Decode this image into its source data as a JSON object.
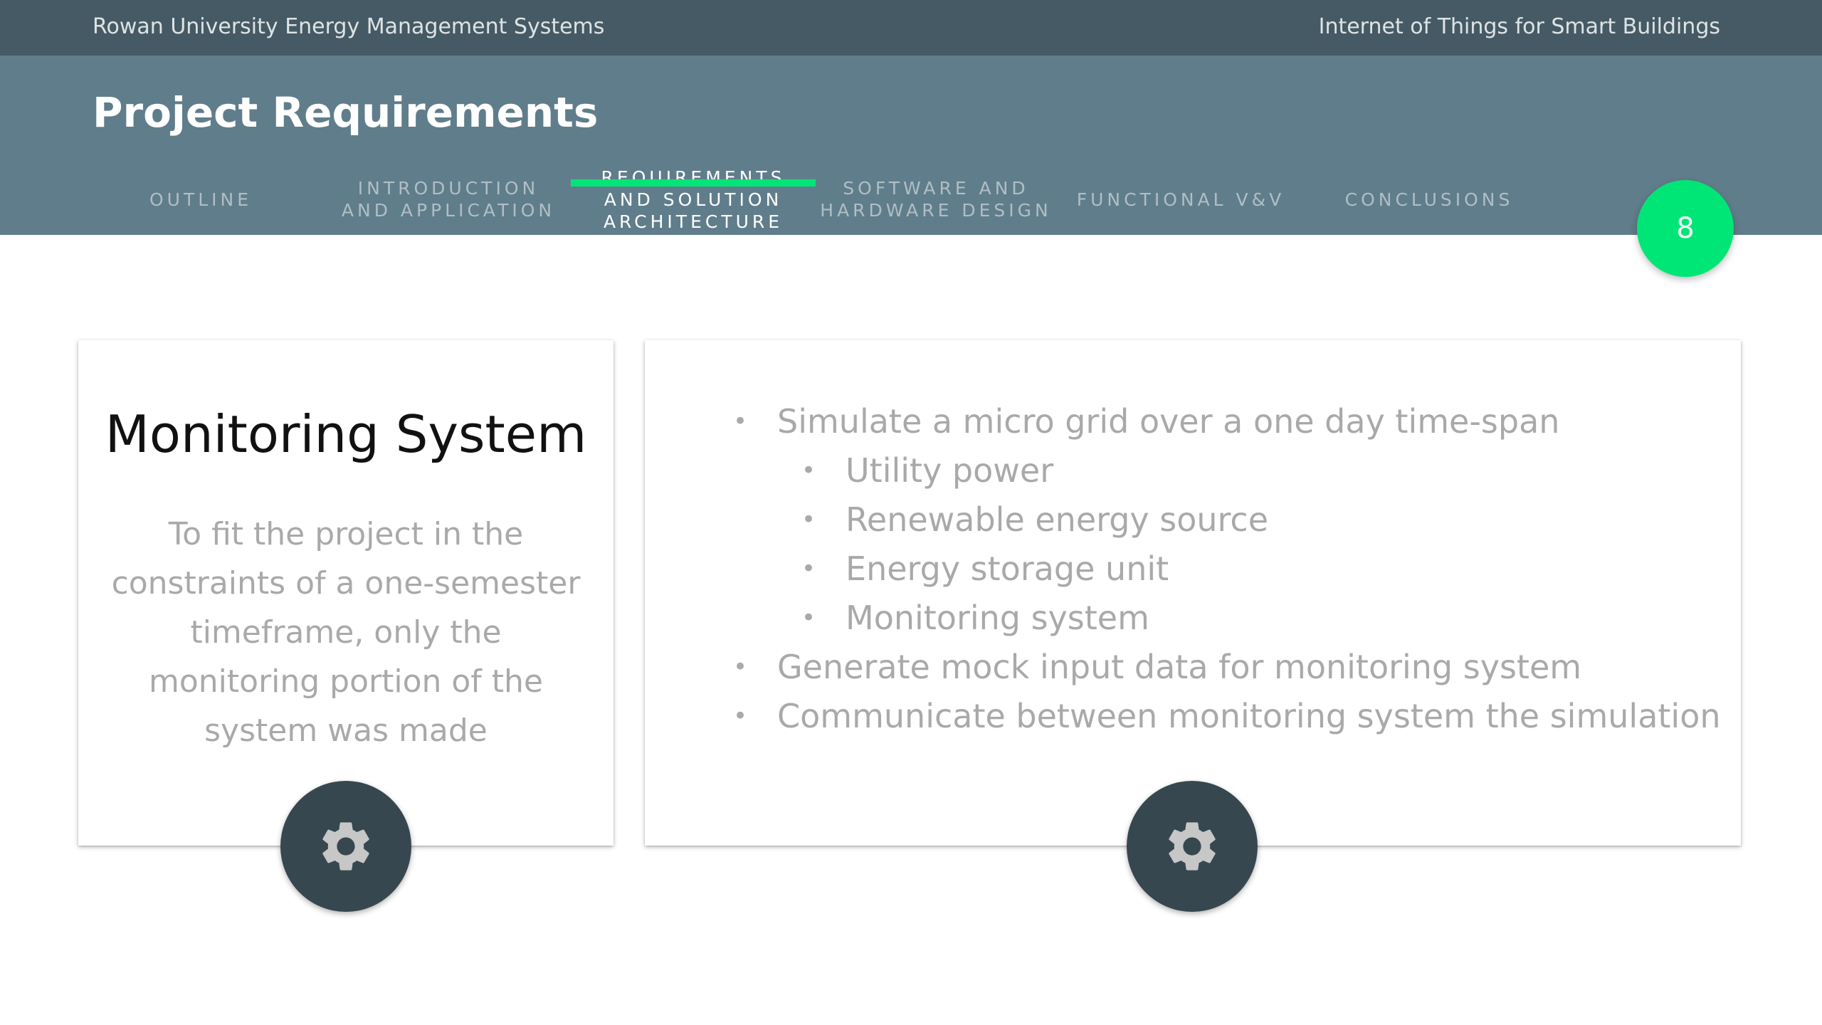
{
  "topbar": {
    "left_title": "Rowan University Energy Management Systems",
    "right_title": "Internet of Things for Smart Buildings"
  },
  "header": {
    "title": "Project Requirements"
  },
  "nav": {
    "items": [
      {
        "label": "OUTLINE",
        "active": false
      },
      {
        "label": "INTRODUCTION AND APPLICATION",
        "active": false
      },
      {
        "label": "REQUIREMENTS AND SOLUTION ARCHITECTURE",
        "active": true
      },
      {
        "label": "SOFTWARE AND HARDWARE DESIGN",
        "active": false
      },
      {
        "label": "FUNCTIONAL V&V",
        "active": false
      },
      {
        "label": "CONCLUSIONS",
        "active": false
      }
    ]
  },
  "page_number": "8",
  "card_left": {
    "title": "Monitoring System",
    "description": "To fit the project in the constraints of a one-semester timeframe, only the monitoring portion of the system was made",
    "icon": "gear-icon"
  },
  "card_right": {
    "bullets": [
      {
        "text": "Simulate a micro grid over a one day time-span",
        "level": 1
      },
      {
        "text": "Utility power",
        "level": 2
      },
      {
        "text": "Renewable energy source",
        "level": 2
      },
      {
        "text": "Energy storage unit",
        "level": 2
      },
      {
        "text": "Monitoring system",
        "level": 2
      },
      {
        "text": "Generate mock input data for monitoring system",
        "level": 1
      },
      {
        "text": "Communicate between monitoring system the simulation",
        "level": 1
      }
    ],
    "icon": "gear-icon"
  },
  "colors": {
    "topbar": "#455a64",
    "header": "#607d8b",
    "accent": "#00e676",
    "gear_button": "#37474f",
    "muted_text": "#a9a9a9"
  }
}
